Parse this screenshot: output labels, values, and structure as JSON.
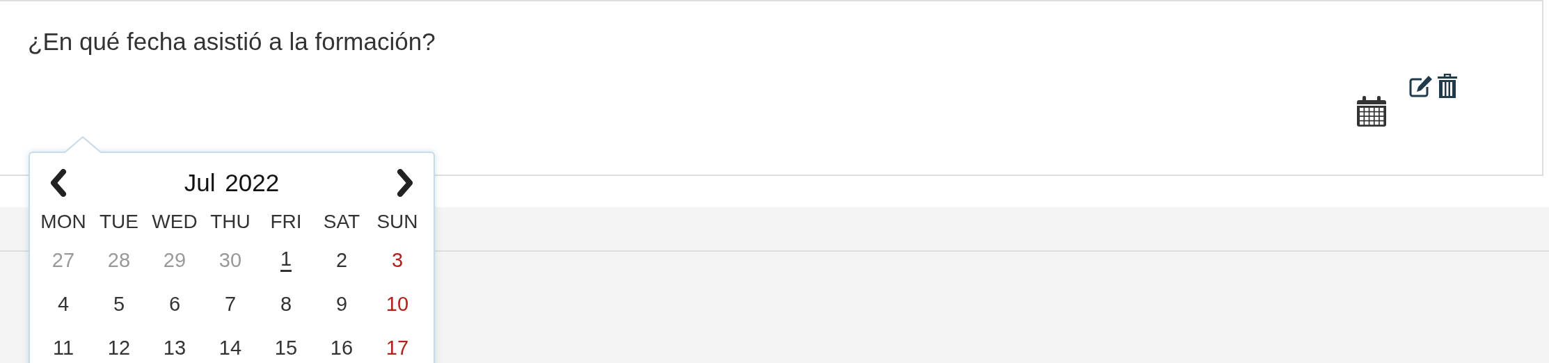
{
  "question": {
    "text": "¿En qué fecha asistió a la formación?"
  },
  "datepicker": {
    "title": "Jul 2022",
    "weekdays": [
      "MON",
      "TUE",
      "WED",
      "THU",
      "FRI",
      "SAT",
      "SUN"
    ],
    "weeks": [
      [
        {
          "day": "27",
          "muted": true,
          "sunday": false,
          "today": false
        },
        {
          "day": "28",
          "muted": true,
          "sunday": false,
          "today": false
        },
        {
          "day": "29",
          "muted": true,
          "sunday": false,
          "today": false
        },
        {
          "day": "30",
          "muted": true,
          "sunday": false,
          "today": false
        },
        {
          "day": "1",
          "muted": false,
          "sunday": false,
          "today": true
        },
        {
          "day": "2",
          "muted": false,
          "sunday": false,
          "today": false
        },
        {
          "day": "3",
          "muted": false,
          "sunday": true,
          "today": false
        }
      ],
      [
        {
          "day": "4",
          "muted": false,
          "sunday": false,
          "today": false
        },
        {
          "day": "5",
          "muted": false,
          "sunday": false,
          "today": false
        },
        {
          "day": "6",
          "muted": false,
          "sunday": false,
          "today": false
        },
        {
          "day": "7",
          "muted": false,
          "sunday": false,
          "today": false
        },
        {
          "day": "8",
          "muted": false,
          "sunday": false,
          "today": false
        },
        {
          "day": "9",
          "muted": false,
          "sunday": false,
          "today": false
        },
        {
          "day": "10",
          "muted": false,
          "sunday": true,
          "today": false
        }
      ],
      [
        {
          "day": "11",
          "muted": false,
          "sunday": false,
          "today": false
        },
        {
          "day": "12",
          "muted": false,
          "sunday": false,
          "today": false
        },
        {
          "day": "13",
          "muted": false,
          "sunday": false,
          "today": false
        },
        {
          "day": "14",
          "muted": false,
          "sunday": false,
          "today": false
        },
        {
          "day": "15",
          "muted": false,
          "sunday": false,
          "today": false
        },
        {
          "day": "16",
          "muted": false,
          "sunday": false,
          "today": false
        },
        {
          "day": "17",
          "muted": false,
          "sunday": true,
          "today": false
        }
      ]
    ]
  }
}
